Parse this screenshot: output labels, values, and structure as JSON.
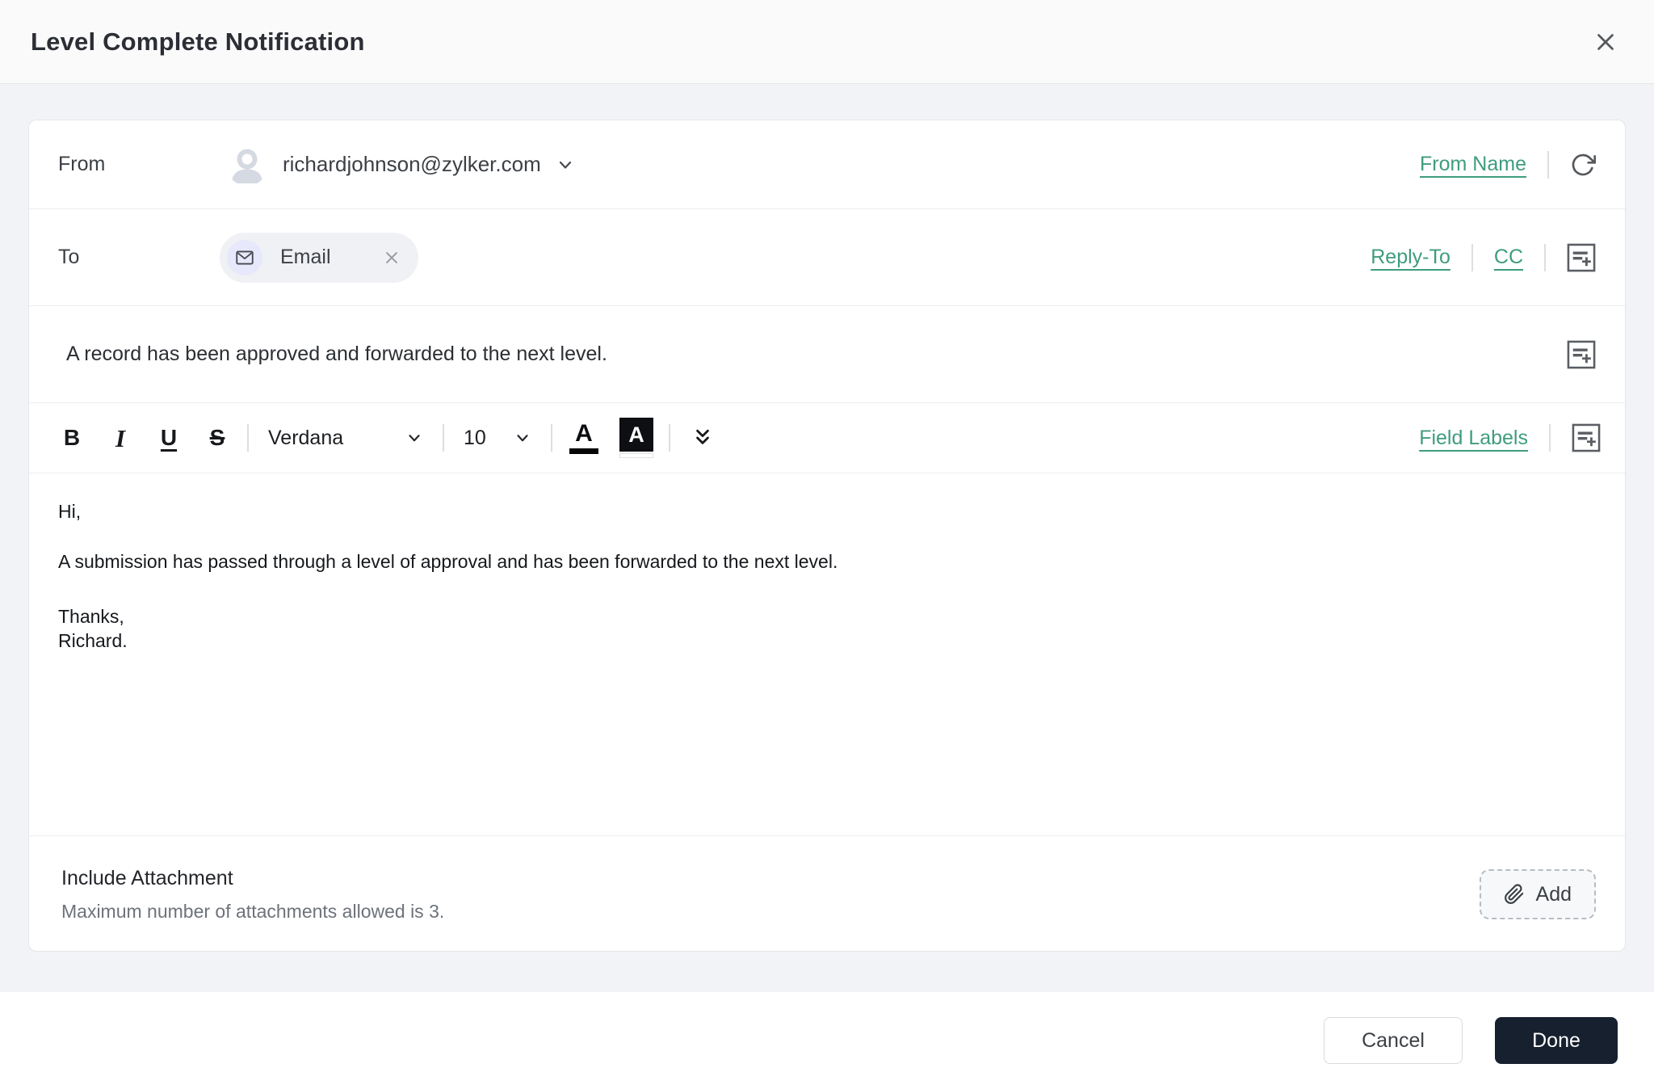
{
  "header": {
    "title": "Level Complete Notification"
  },
  "compose": {
    "from": {
      "label": "From",
      "email": "richardjohnson@zylker.com",
      "from_name_link": "From Name"
    },
    "to": {
      "label": "To",
      "recipient_chip": "Email",
      "reply_to_link": "Reply-To",
      "cc_link": "CC"
    },
    "subject": {
      "value": "A record has been approved and forwarded to the next level."
    },
    "toolbar": {
      "bold": "B",
      "italic": "I",
      "underline": "U",
      "strikethrough": "S",
      "font_family": "Verdana",
      "font_size": "10",
      "text_color_letter": "A",
      "bg_color_letter": "A",
      "field_labels_link": "Field Labels"
    },
    "body": {
      "greeting": "Hi,",
      "paragraph": "A submission has passed through a level of approval and has been forwarded to the next level.",
      "closing_1": "Thanks,",
      "closing_2": "Richard."
    },
    "attachment": {
      "title": "Include Attachment",
      "hint": "Maximum number of attachments allowed is 3.",
      "add_button": "Add"
    }
  },
  "footer": {
    "cancel_button": "Cancel",
    "done_button": "Done"
  },
  "colors": {
    "accent_link": "#3f9c7f",
    "page_background": "#f1f3f6",
    "done_button_bg": "#16202e",
    "chip_bg": "#f0f1f4",
    "chip_circle_bg": "#e7e8fb"
  }
}
